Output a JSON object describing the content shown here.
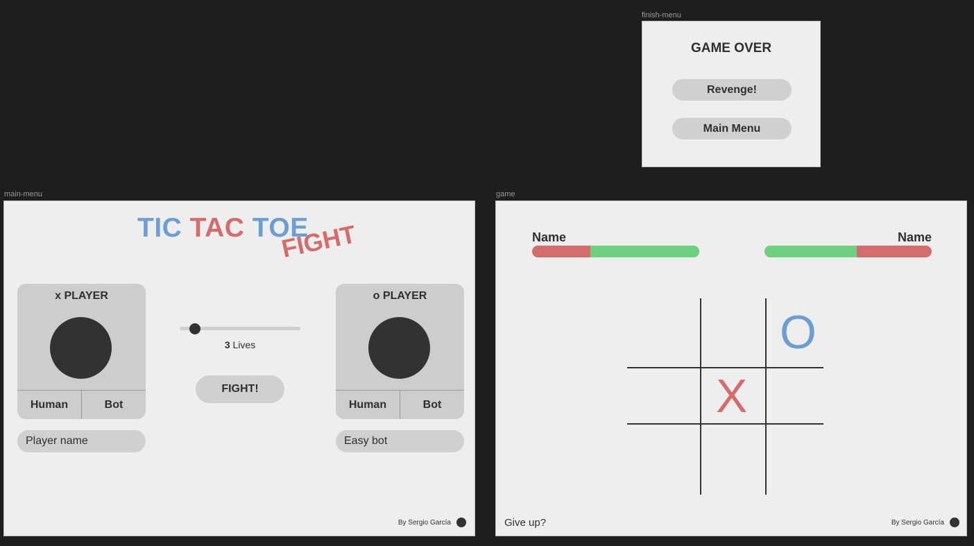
{
  "finish_menu": {
    "frame_label": "finish-menu",
    "title": "GAME OVER",
    "revenge_label": "Revenge!",
    "main_menu_label": "Main Menu"
  },
  "main_menu": {
    "frame_label": "main-menu",
    "logo": {
      "tic": "TIC",
      "tac": "TAC",
      "toe": "TOE",
      "fight": "FIGHT"
    },
    "x_player": {
      "title": "x PLAYER",
      "human_label": "Human",
      "bot_label": "Bot",
      "name_placeholder": "Player name"
    },
    "o_player": {
      "title": "o PLAYER",
      "human_label": "Human",
      "bot_label": "Bot",
      "name_value": "Easy bot"
    },
    "lives": {
      "count": "3",
      "label": "Lives"
    },
    "fight_button": "FIGHT!",
    "credit": "By Sergio García"
  },
  "game": {
    "frame_label": "game",
    "player1_name": "Name",
    "player2_name": "Name",
    "player1_hp_fraction": 0.65,
    "player2_hp_fraction": 0.55,
    "board": [
      "",
      "",
      "O",
      "",
      "X",
      "",
      "",
      "",
      ""
    ],
    "give_up_label": "Give up?",
    "credit": "By Sergio García"
  },
  "colors": {
    "blue": "#6d9ed3",
    "red": "#d36d6d",
    "green": "#6ed17f",
    "dark": "#323232"
  }
}
